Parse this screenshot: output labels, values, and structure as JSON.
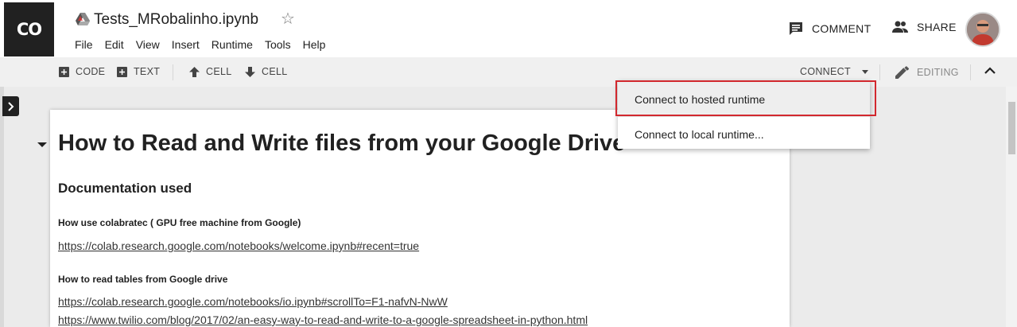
{
  "app": {
    "logo_text": "CO",
    "notebook_title": "Tests_MRobalinho.ipynb"
  },
  "menu": [
    "File",
    "Edit",
    "View",
    "Insert",
    "Runtime",
    "Tools",
    "Help"
  ],
  "header_actions": {
    "comment_label": "COMMENT",
    "share_label": "SHARE"
  },
  "toolbar": {
    "add_code_label": "CODE",
    "add_text_label": "TEXT",
    "cell_up_label": "CELL",
    "cell_down_label": "CELL",
    "connect_label": "CONNECT",
    "editing_label": "EDITING"
  },
  "connect_menu": {
    "items": [
      "Connect to hosted runtime",
      "Connect to local runtime..."
    ]
  },
  "notebook": {
    "heading": "How to Read and Write files from your Google Drive",
    "subheading": "Documentation used",
    "section1_label": "How use colabratec ( GPU free machine from Google)",
    "section1_link": "https://colab.research.google.com/notebooks/welcome.ipynb#recent=true",
    "section2_label": "How to read tables from Google drive",
    "section2_link1": "https://colab.research.google.com/notebooks/io.ipynb#scrollTo=F1-nafvN-NwW",
    "section2_link2": "https://www.twilio.com/blog/2017/02/an-easy-way-to-read-and-write-to-a-google-spreadsheet-in-python.html"
  },
  "colors": {
    "logo_bg": "#212121",
    "highlight_outline": "#d2282e",
    "toolbar_bg": "#f0f0f0"
  }
}
